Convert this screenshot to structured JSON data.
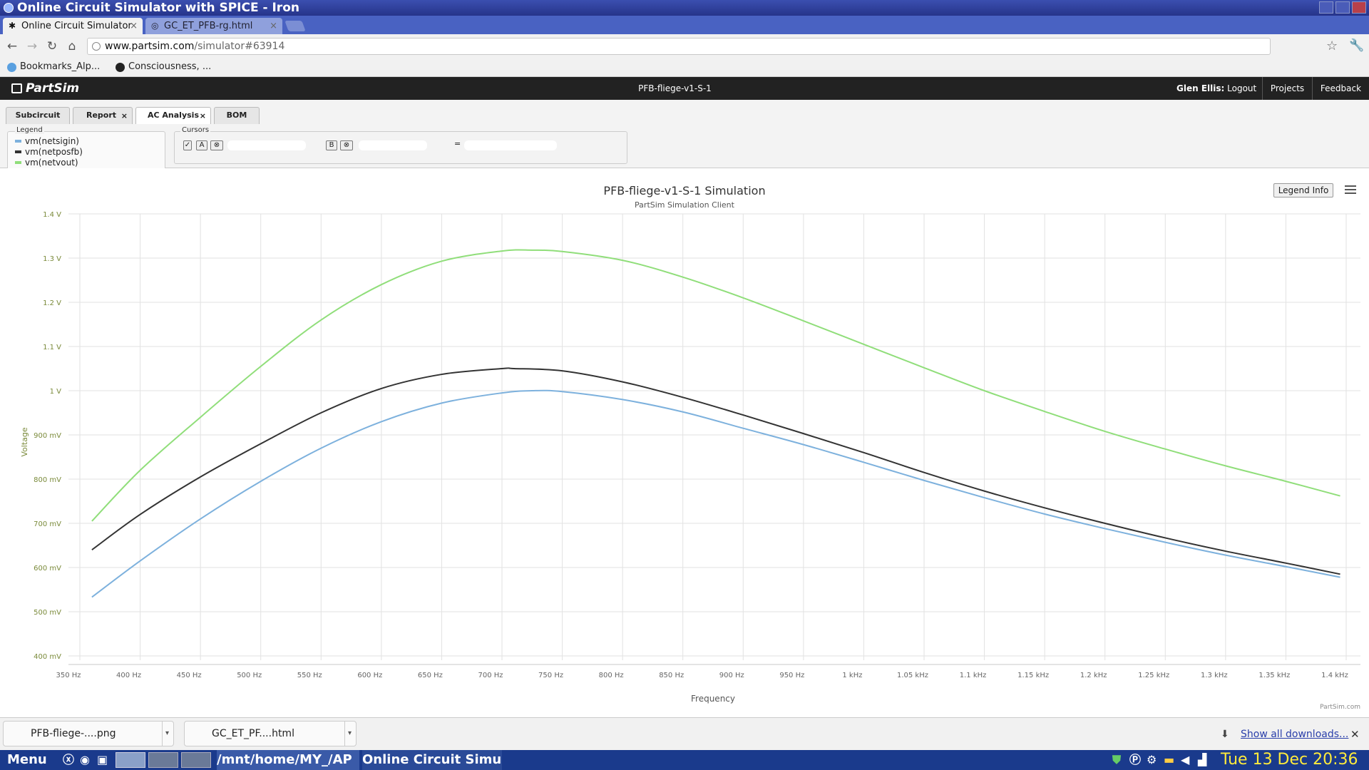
{
  "window": {
    "title": "Online Circuit Simulator with SPICE - Iron"
  },
  "browser_tabs": [
    {
      "label": "Online Circuit Simulator"
    },
    {
      "label": "GC_ET_PFB-rg.html"
    }
  ],
  "address": {
    "host": "www.partsim.com",
    "path": "/simulator#63914"
  },
  "bookmarks": [
    {
      "label": "Bookmarks_Alp..."
    },
    {
      "label": "Consciousness, ..."
    }
  ],
  "partsim": {
    "logo": "PartSim",
    "project": "PFB-fliege-v1-S-1",
    "user": "Glen Ellis:",
    "logout": "Logout",
    "projects": "Projects",
    "feedback": "Feedback"
  },
  "subtabs": [
    {
      "label": "Subcircuit",
      "active": false,
      "closable": false
    },
    {
      "label": "Report",
      "active": false,
      "closable": true
    },
    {
      "label": "AC Analysis",
      "active": true,
      "closable": true
    },
    {
      "label": "BOM",
      "active": false,
      "closable": false
    }
  ],
  "legend_panel": {
    "title": "Legend",
    "items": [
      {
        "label": "vm(netsigin)",
        "color": "#7db1dd"
      },
      {
        "label": "vm(netposfb)",
        "color": "#333333"
      },
      {
        "label": "vm(netvout)",
        "color": "#90de7a"
      }
    ]
  },
  "cursors": {
    "title": "Cursors",
    "a_label": "A",
    "b_label": "B",
    "eq": "="
  },
  "legend_info_button": "Legend Info",
  "credit": "PartSim.com",
  "chart_data": {
    "type": "line",
    "title": "PFB-fliege-v1-S-1 Simulation",
    "subtitle": "PartSim Simulation Client",
    "xlabel": "Frequency",
    "ylabel": "Voltage",
    "xlim": [
      350,
      1400
    ],
    "ylim": [
      0.4,
      1.4
    ],
    "x_ticks": [
      350,
      400,
      450,
      500,
      550,
      600,
      650,
      700,
      750,
      800,
      850,
      900,
      950,
      1000,
      1050,
      1100,
      1150,
      1200,
      1250,
      1300,
      1350,
      1400
    ],
    "x_tick_labels": [
      "350 Hz",
      "400 Hz",
      "450 Hz",
      "500 Hz",
      "550 Hz",
      "600 Hz",
      "650 Hz",
      "700 Hz",
      "750 Hz",
      "800 Hz",
      "850 Hz",
      "900 Hz",
      "950 Hz",
      "1 kHz",
      "1.05 kHz",
      "1.1 kHz",
      "1.15 kHz",
      "1.2 kHz",
      "1.25 kHz",
      "1.3 kHz",
      "1.35 kHz",
      "1.4 kHz"
    ],
    "y_ticks": [
      0.4,
      0.5,
      0.6,
      0.7,
      0.8,
      0.9,
      1.0,
      1.1,
      1.2,
      1.3,
      1.4
    ],
    "y_tick_labels": [
      "400 mV",
      "500 mV",
      "600 mV",
      "700 mV",
      "800 mV",
      "900 mV",
      "1 V",
      "1.1 V",
      "1.2 V",
      "1.3 V",
      "1.4 V"
    ],
    "grid": true,
    "series": [
      {
        "name": "vm(netsigin)",
        "color": "#7db1dd",
        "x": [
          360,
          400,
          450,
          500,
          550,
          600,
          650,
          700,
          725,
          750,
          800,
          850,
          900,
          950,
          1000,
          1050,
          1100,
          1150,
          1200,
          1250,
          1300,
          1350,
          1395
        ],
        "y": [
          0.533,
          0.615,
          0.71,
          0.795,
          0.87,
          0.93,
          0.972,
          0.995,
          1.0,
          0.998,
          0.98,
          0.952,
          0.915,
          0.878,
          0.838,
          0.797,
          0.758,
          0.721,
          0.688,
          0.657,
          0.628,
          0.602,
          0.578
        ]
      },
      {
        "name": "vm(netposfb)",
        "color": "#333333",
        "x": [
          360,
          400,
          450,
          500,
          550,
          600,
          650,
          700,
          710,
          750,
          800,
          850,
          900,
          950,
          1000,
          1050,
          1100,
          1150,
          1200,
          1250,
          1300,
          1350,
          1395
        ],
        "y": [
          0.64,
          0.72,
          0.805,
          0.88,
          0.95,
          1.005,
          1.037,
          1.05,
          1.05,
          1.045,
          1.02,
          0.985,
          0.945,
          0.903,
          0.86,
          0.815,
          0.773,
          0.735,
          0.7,
          0.667,
          0.637,
          0.61,
          0.585
        ]
      },
      {
        "name": "vm(netvout)",
        "color": "#90de7a",
        "x": [
          360,
          400,
          450,
          500,
          550,
          600,
          650,
          700,
          725,
          750,
          800,
          850,
          900,
          950,
          1000,
          1050,
          1100,
          1150,
          1200,
          1250,
          1300,
          1350,
          1395
        ],
        "y": [
          0.705,
          0.82,
          0.94,
          1.055,
          1.16,
          1.24,
          1.293,
          1.316,
          1.318,
          1.315,
          1.295,
          1.257,
          1.21,
          1.158,
          1.105,
          1.052,
          1.0,
          0.953,
          0.908,
          0.868,
          0.83,
          0.795,
          0.762
        ]
      }
    ]
  },
  "downloads": [
    {
      "label": "PFB-fliege-....png"
    },
    {
      "label": "GC_ET_PF....html"
    }
  ],
  "show_all_downloads": "Show all downloads...",
  "taskbar": {
    "menu": "Menu",
    "task1": "/mnt/home/MY_/AP",
    "task2": "Online Circuit Simu",
    "clock": "Tue 13 Dec 20:36"
  }
}
